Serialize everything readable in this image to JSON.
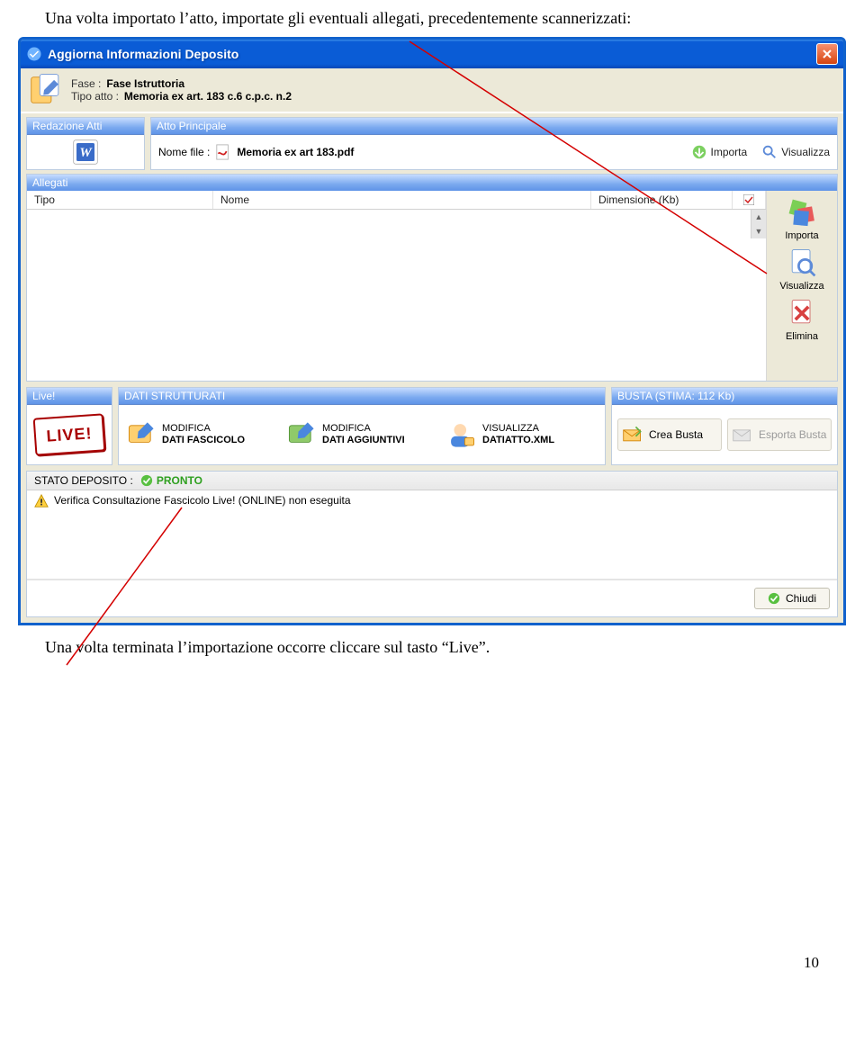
{
  "intro_text": "Una volta importato l’atto, importate gli eventuali allegati, precedentemente scannerizzati:",
  "outro_text": "Una volta terminata l’importazione occorre cliccare sul tasto “Live”.",
  "page_number": "10",
  "window": {
    "title": "Aggiorna Informazioni Deposito",
    "fase_label": "Fase :",
    "fase_value": "Fase Istruttoria",
    "tipo_label": "Tipo atto :",
    "tipo_value": "Memoria ex art. 183 c.6 c.p.c. n.2"
  },
  "redazione": {
    "title": "Redazione Atti"
  },
  "atto_principale": {
    "title": "Atto Principale",
    "nome_file_label": "Nome file :",
    "nome_file_value": "Memoria ex art 183.pdf",
    "importa": "Importa",
    "visualizza": "Visualizza"
  },
  "allegati": {
    "title": "Allegati",
    "col_tipo": "Tipo",
    "col_nome": "Nome",
    "col_dim": "Dimensione (Kb)",
    "btn_importa": "Importa",
    "btn_visualizza": "Visualizza",
    "btn_elimina": "Elimina"
  },
  "live": {
    "title": "Live!",
    "stamp": "LIVE!"
  },
  "dati": {
    "title": "DATI STRUTTURATI",
    "btn1_l1": "MODIFICA",
    "btn1_l2": "DATI FASCICOLO",
    "btn2_l1": "MODIFICA",
    "btn2_l2": "DATI AGGIUNTIVI",
    "btn3_l1": "VISUALIZZA",
    "btn3_l2": "DATIATTO.XML"
  },
  "busta": {
    "title": "BUSTA (STIMA: 112 Kb)",
    "crea": "Crea Busta",
    "esporta": "Esporta Busta"
  },
  "status": {
    "label": "STATO DEPOSITO :",
    "value": "PRONTO",
    "message": "Verifica Consultazione Fascicolo Live! (ONLINE) non eseguita"
  },
  "chiudi": "Chiudi"
}
